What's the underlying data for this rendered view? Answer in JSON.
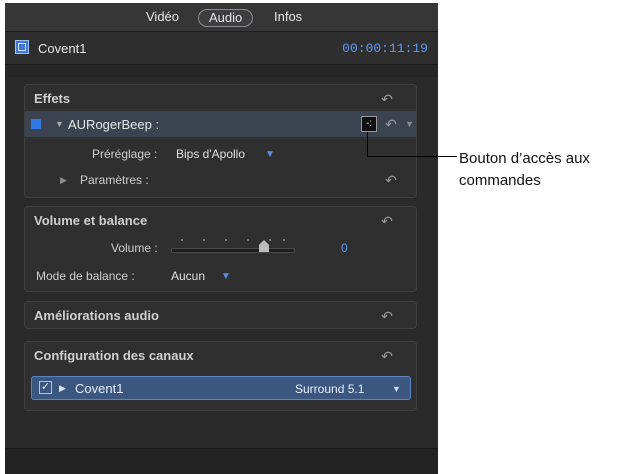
{
  "tabs": [
    {
      "label": "Vidéo",
      "active": false
    },
    {
      "label": "Audio",
      "active": true
    },
    {
      "label": "Infos",
      "active": false
    }
  ],
  "clip": {
    "name": "Covent1",
    "timecode": "00:00:11:19",
    "icon": "clip-icon"
  },
  "effects": {
    "title": "Effets",
    "effect_name": "AURogerBeep :",
    "control_button_icon": "controls-window-icon",
    "preset_label": "Préréglage :",
    "preset_value": "Bips d'Apollo",
    "params_label": "Paramètres :"
  },
  "volume": {
    "title": "Volume et balance",
    "volume_label": "Volume :",
    "volume_value": "0",
    "pan_label": "Mode de balance :",
    "pan_value": "Aucun"
  },
  "enhancements": {
    "title": "Améliorations audio"
  },
  "channels": {
    "title": "Configuration des canaux",
    "clip_name": "Covent1",
    "config": "Surround 5.1",
    "checked": true
  },
  "callout": {
    "text": "Bouton d’accès aux commandes"
  },
  "colors": {
    "accent": "#5b9cf4",
    "selection": "#3b5780",
    "panel": "#2a2a2b"
  }
}
